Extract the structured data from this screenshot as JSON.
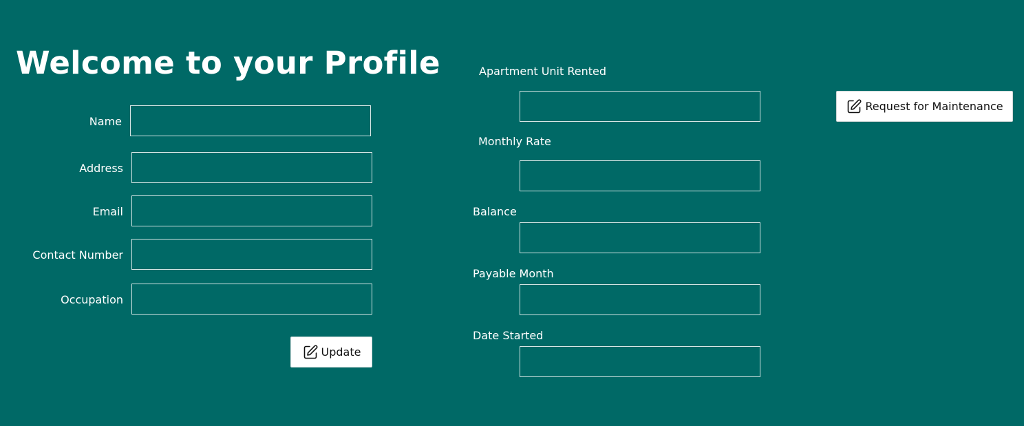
{
  "page": {
    "title": "Welcome to your Profile"
  },
  "profile_form": {
    "name_label": "Name",
    "name_value": "",
    "address_label": "Address",
    "address_value": "",
    "email_label": "Email",
    "email_value": "",
    "contact_label": "Contact Number",
    "contact_value": "",
    "occupation_label": "Occupation",
    "occupation_value": "",
    "update_label": "Update"
  },
  "rental_info": {
    "unit_label": "Apartment Unit Rented",
    "unit_value": "",
    "rate_label": "Monthly Rate",
    "rate_value": "",
    "balance_label": "Balance",
    "balance_value": "",
    "payable_label": "Payable Month",
    "payable_value": "",
    "date_label": "Date Started",
    "date_value": ""
  },
  "actions": {
    "maintenance_label": "Request for Maintenance"
  },
  "colors": {
    "background": "#006966",
    "field_border": "#d6e6e5",
    "button_bg": "#ffffff"
  },
  "icons": {
    "update_icon": "edit-icon",
    "maintenance_icon": "edit-icon"
  }
}
